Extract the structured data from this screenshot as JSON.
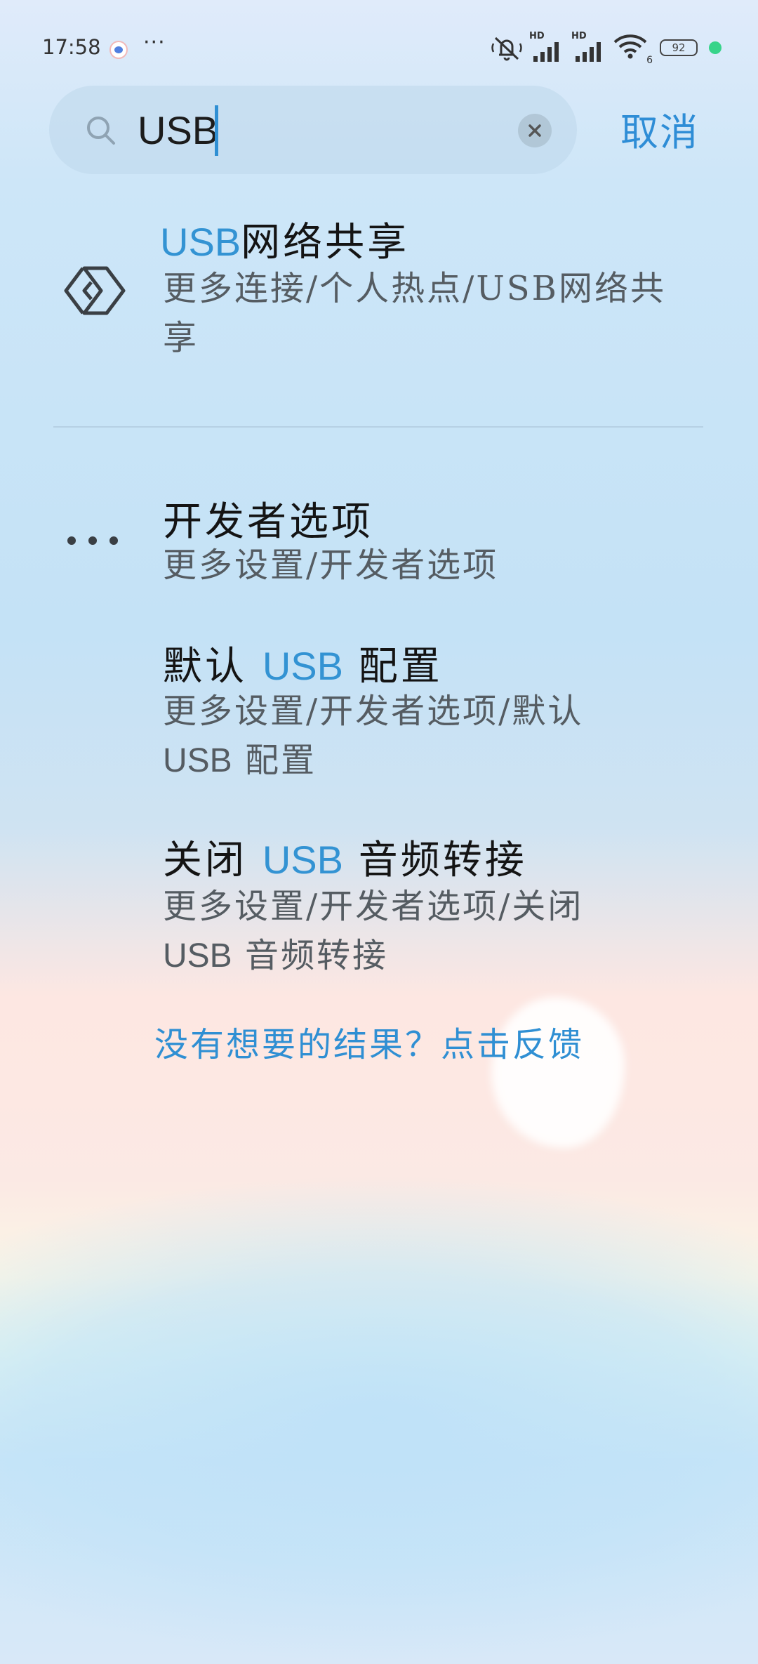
{
  "status_bar": {
    "time": "17:58",
    "more": "···",
    "network_badge_1": "HD",
    "network_badge_2": "HD",
    "wifi_badge": "6",
    "battery_level": "92",
    "icons": [
      "app-notification-icon",
      "mute-vibrate-icon",
      "signal-icon",
      "wifi-icon",
      "battery-icon",
      "charging-dot-icon"
    ]
  },
  "search": {
    "value": "USB",
    "icon": "search-icon",
    "clear_icon": "close-icon",
    "cancel_label": "取消"
  },
  "results": [
    {
      "icon": "hotspot-icon",
      "title_highlight": "USB",
      "title_rest": "网络共享",
      "path_line1": "更多连接/个人热点/USB网络共",
      "path_line2": "享"
    },
    {
      "icon": "more-dots-icon",
      "title": "开发者选项",
      "path": "更多设置/开发者选项"
    },
    {
      "title_before": "默认",
      "title_highlight": "USB",
      "title_after": "配置",
      "path_line1": "更多设置/开发者选项/默认",
      "path_line2_en": "USB",
      "path_line2_cn": "配置"
    },
    {
      "title_before": "关闭",
      "title_highlight": "USB",
      "title_after": "音频转接",
      "path_line1": "更多设置/开发者选项/关闭",
      "path_line2_en": "USB",
      "path_line2_cn": "音频转接"
    }
  ],
  "feedback": {
    "label": "没有想要的结果？点击反馈"
  },
  "colors": {
    "accent": "#3393d3",
    "title_text": "#141414",
    "path_text": "#555c62"
  }
}
